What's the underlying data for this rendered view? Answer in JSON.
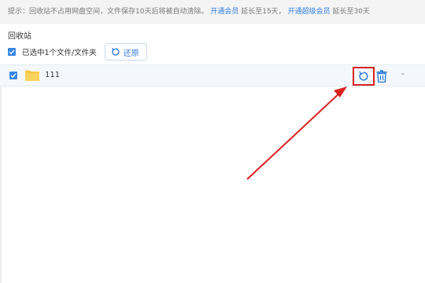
{
  "notice": {
    "prefix": "提示：回收站不占用网盘空间，文件保存10天后将被自动清除。",
    "vip_link": "开通会员",
    "vip_extend": " 延长至15天，",
    "svip_link": "开通超级会员",
    "svip_extend": " 延长至30天"
  },
  "section_title": "回收站",
  "selection": {
    "label": "已选中1个文件/文件夹",
    "restore_label": "还原"
  },
  "file": {
    "name": "111",
    "extra": "-"
  },
  "colors": {
    "accent": "#2f7ddc",
    "highlight": "#d9231f"
  }
}
